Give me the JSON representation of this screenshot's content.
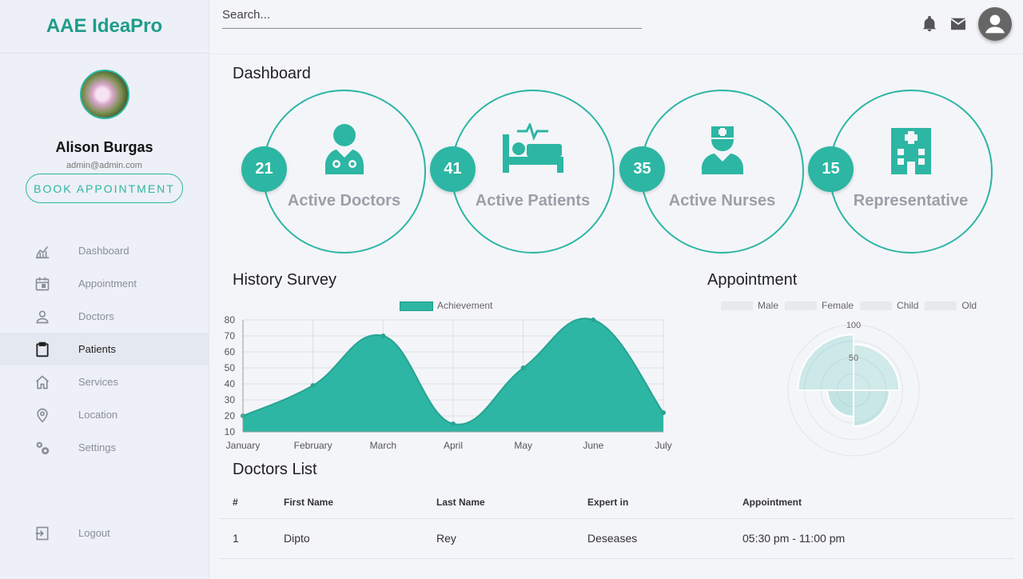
{
  "brand": "AAE IdeaPro",
  "search": {
    "placeholder": "Search..."
  },
  "profile": {
    "name": "Alison Burgas",
    "email": "admin@admin.com",
    "book_label": "BOOK APPOINTMENT"
  },
  "nav": [
    {
      "label": "Dashboard",
      "icon": "chart-icon"
    },
    {
      "label": "Appointment",
      "icon": "calendar-icon"
    },
    {
      "label": "Doctors",
      "icon": "person-icon"
    },
    {
      "label": "Patients",
      "icon": "clipboard-icon",
      "active": true
    },
    {
      "label": "Services",
      "icon": "home-icon"
    },
    {
      "label": "Location",
      "icon": "location-pin-icon"
    },
    {
      "label": "Settings",
      "icon": "gears-icon"
    }
  ],
  "logout_label": "Logout",
  "dashboard_title": "Dashboard",
  "stats": [
    {
      "count": "21",
      "label": "Active Doctors",
      "icon": "doctor-icon"
    },
    {
      "count": "41",
      "label": "Active Patients",
      "icon": "hospital-bed-icon"
    },
    {
      "count": "35",
      "label": "Active Nurses",
      "icon": "nurse-icon"
    },
    {
      "count": "15",
      "label": "Representative",
      "icon": "hospital-building-icon"
    }
  ],
  "history_title": "History Survey",
  "appointment_title": "Appointment",
  "doctors_title": "Doctors List",
  "accent": "#2db6a3",
  "chart_data": [
    {
      "type": "area",
      "title": "",
      "legend": [
        "Achievement"
      ],
      "x": [
        "January",
        "February",
        "March",
        "April",
        "May",
        "June",
        "July"
      ],
      "series": [
        {
          "name": "Achievement",
          "values": [
            20,
            39,
            70,
            15,
            50,
            80,
            22
          ]
        }
      ],
      "ylim": [
        10,
        80
      ],
      "yticks": [
        10,
        20,
        30,
        40,
        50,
        60,
        70,
        80
      ],
      "grid": true,
      "legend_position": "top"
    },
    {
      "type": "polarArea",
      "title": "",
      "categories": [
        "Male",
        "Female",
        "Child",
        "Old"
      ],
      "values": [
        70,
        55,
        40,
        85
      ],
      "rticks": [
        50,
        100
      ],
      "legend_position": "top"
    }
  ],
  "table": {
    "headers": [
      "#",
      "First Name",
      "Last Name",
      "Expert in",
      "Appointment"
    ],
    "rows": [
      [
        "1",
        "Dipto",
        "Rey",
        "Deseases",
        "05:30 pm - 11:00 pm"
      ]
    ]
  }
}
